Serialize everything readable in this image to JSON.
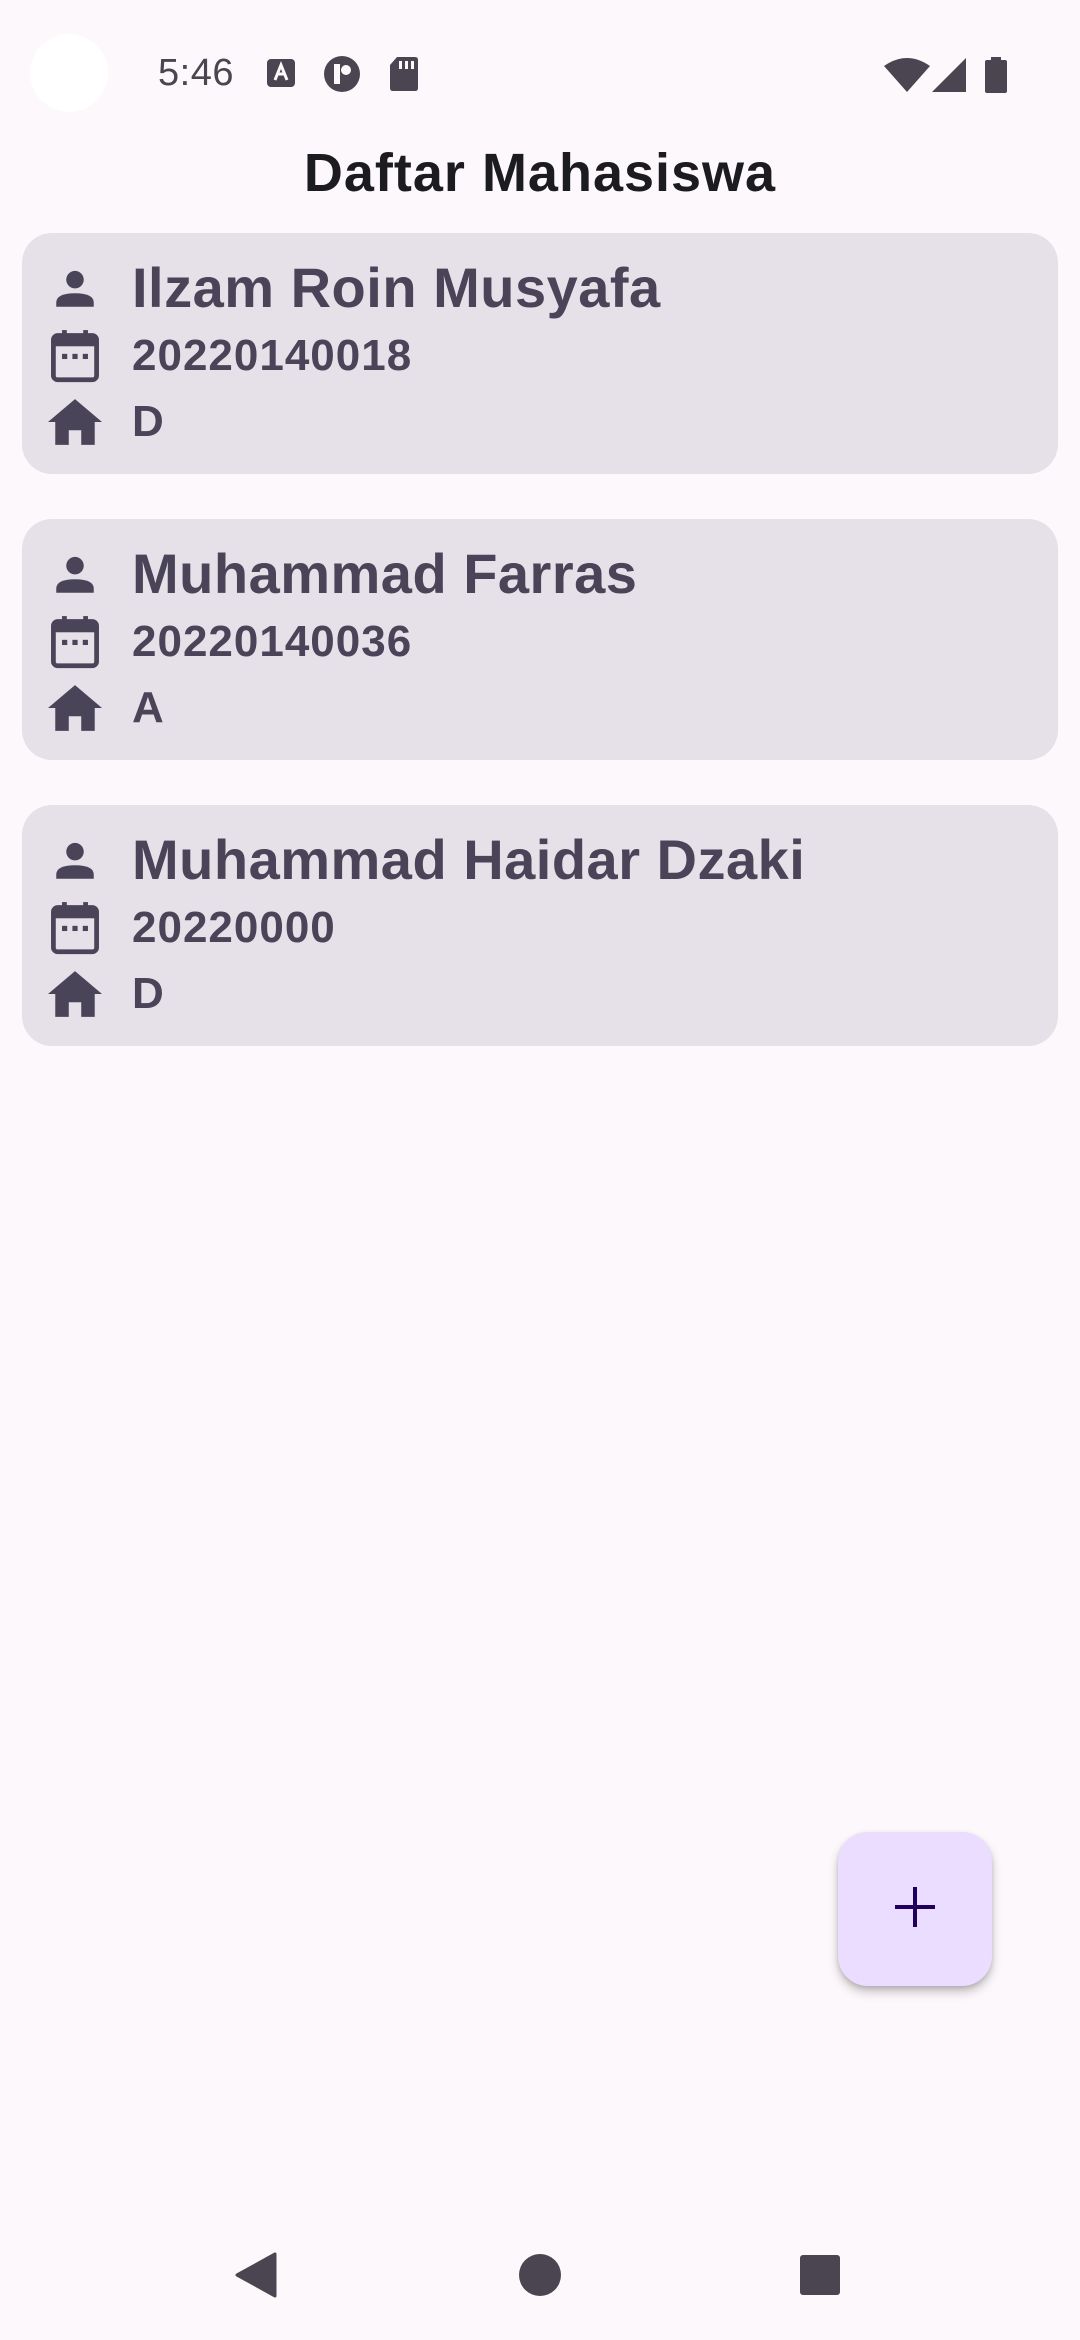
{
  "status_bar": {
    "time": "5:46",
    "icons": [
      "accessibility-a-icon",
      "pocket-casts-icon",
      "sd-card-icon",
      "wifi-icon",
      "signal-icon",
      "battery-icon"
    ]
  },
  "app": {
    "title": "Daftar Mahasiswa"
  },
  "students": [
    {
      "name": "Ilzam Roin Musyafa",
      "nim": "20220140018",
      "class": "D"
    },
    {
      "name": "Muhammad Farras",
      "nim": "20220140036",
      "class": "A"
    },
    {
      "name": "Muhammad Haidar Dzaki",
      "nim": "20220000",
      "class": "D"
    }
  ],
  "row_icons": [
    "person-icon",
    "calendar-icon",
    "home-icon"
  ],
  "fab": {
    "icon": "plus-icon"
  },
  "nav": {
    "buttons": [
      "back-icon",
      "home-circle-icon",
      "recents-icon"
    ]
  },
  "colors": {
    "background": "#fdf8fb",
    "card": "#e6e0e9",
    "card_text": "#4a4458",
    "fab": "#eaddff",
    "fab_icon": "#21005d"
  }
}
